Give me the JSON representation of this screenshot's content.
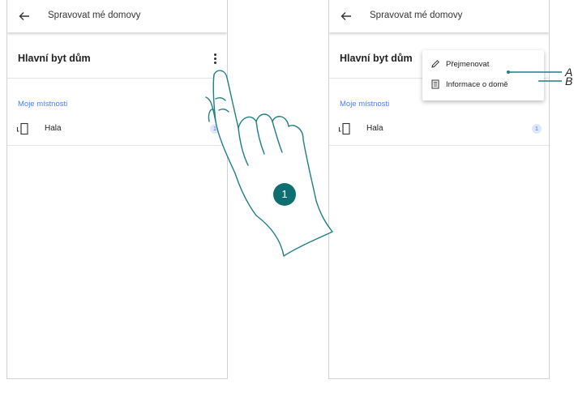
{
  "left_screen": {
    "appbar": {
      "title": "Spravovat mé domovy"
    },
    "home": {
      "name": "Hlavní byt dům"
    },
    "section_label": "Moje místnosti",
    "rooms": [
      {
        "name": "Hala",
        "count": "1"
      }
    ]
  },
  "right_screen": {
    "appbar": {
      "title": "Spravovat mé domovy"
    },
    "home": {
      "name": "Hlavní byt dům"
    },
    "section_label": "Moje místnosti",
    "rooms": [
      {
        "name": "Hala",
        "count": "1"
      }
    ],
    "menu": {
      "items": [
        {
          "label": "Přejmenovat",
          "icon": "pencil-icon"
        },
        {
          "label": "Informace o domě",
          "icon": "document-icon"
        }
      ]
    }
  },
  "annotations": {
    "step": "1",
    "callout_a": "A",
    "callout_b": "B"
  },
  "colors": {
    "accent_blue": "#4a7fe6",
    "hand_stroke": "#1f7f85",
    "step_badge": "#0e6f73"
  }
}
